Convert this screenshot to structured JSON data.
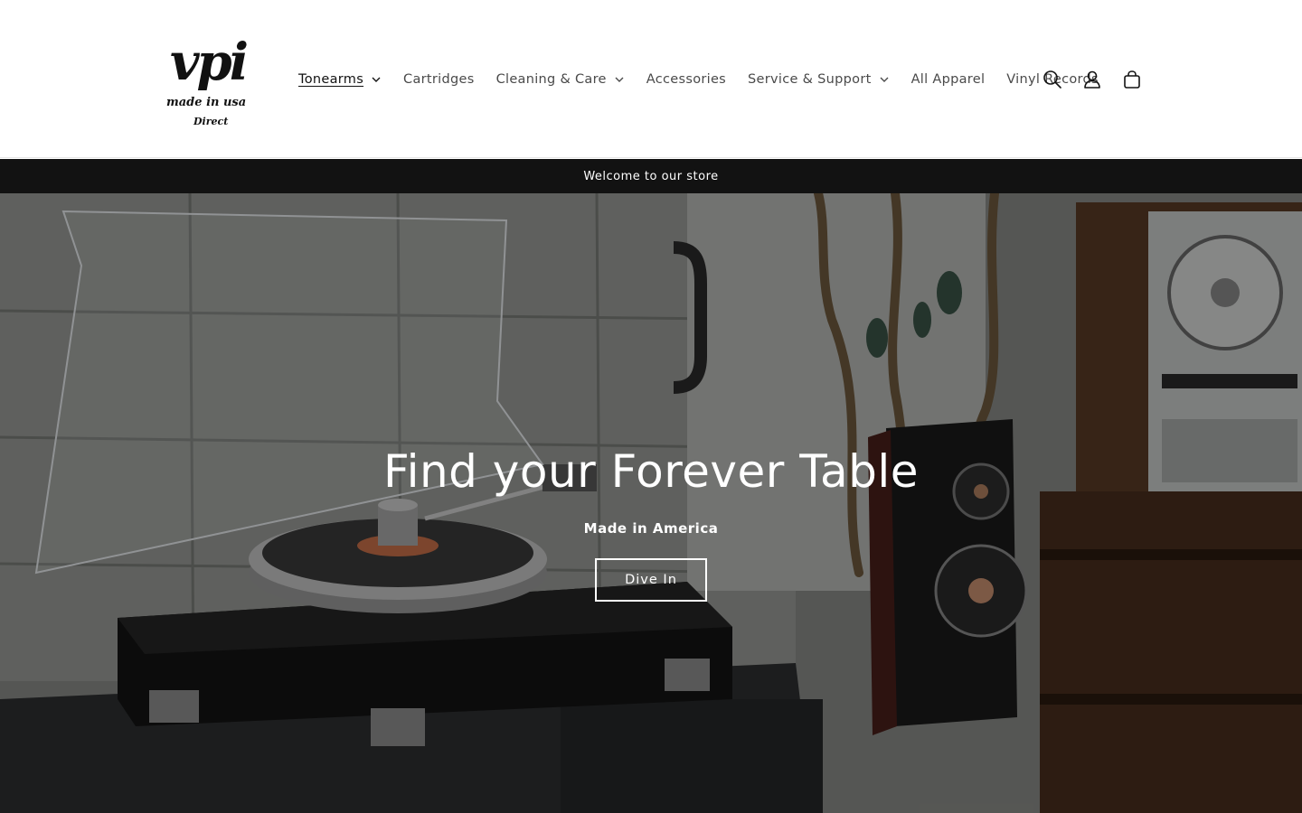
{
  "brand": {
    "logo_mark": "vpi",
    "logo_line1": "made in usa",
    "logo_line2": "Direct"
  },
  "nav": {
    "items": [
      {
        "label": "Tonearms",
        "has_dropdown": true,
        "active": true
      },
      {
        "label": "Cartridges",
        "has_dropdown": false
      },
      {
        "label": "Cleaning & Care",
        "has_dropdown": true
      },
      {
        "label": "Accessories",
        "has_dropdown": false
      },
      {
        "label": "Service & Support",
        "has_dropdown": true
      },
      {
        "label": "All Apparel",
        "has_dropdown": false
      },
      {
        "label": "Vinyl Records",
        "has_dropdown": false
      }
    ]
  },
  "header_icons": [
    "search-icon",
    "account-icon",
    "cart-icon"
  ],
  "announcement": {
    "text": "Welcome to our store"
  },
  "hero": {
    "title": "Find your Forever Table",
    "subtitle": "Made in America",
    "button_label": "Dive In"
  },
  "colors": {
    "announcement_bg": "#121212",
    "text_primary": "#121212",
    "nav_text": "#4a4a4a",
    "hero_text": "#ffffff"
  }
}
